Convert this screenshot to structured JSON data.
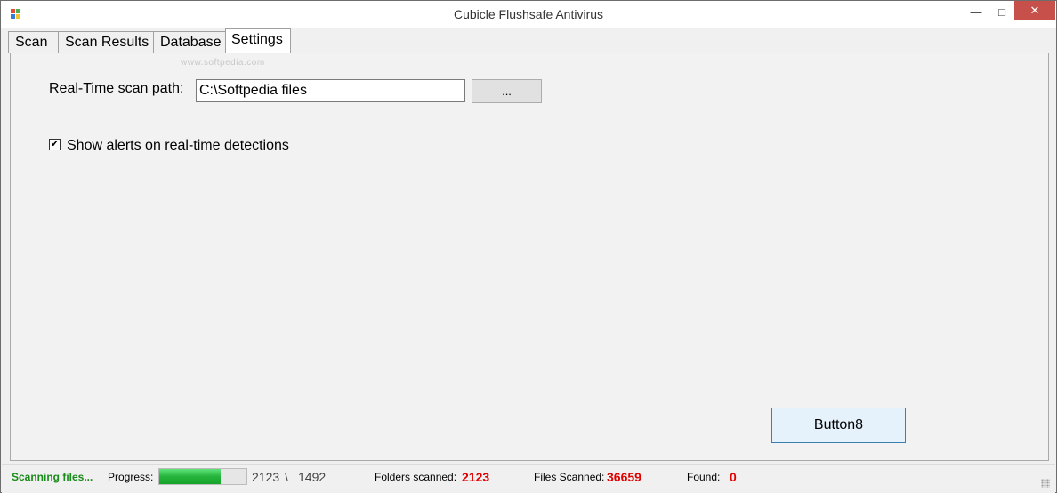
{
  "window": {
    "title": "Cubicle Flushsafe Antivirus",
    "controls": {
      "minimize": "—",
      "maximize": "□",
      "close": "✕"
    }
  },
  "tabs": [
    {
      "label": "Scan",
      "active": false
    },
    {
      "label": "Scan Results",
      "active": false
    },
    {
      "label": "Database",
      "active": false
    },
    {
      "label": "Settings",
      "active": true
    }
  ],
  "watermark": "www.softpedia.com",
  "settings": {
    "scan_path_label": "Real-Time scan path:",
    "scan_path_value": "C:\\Softpedia files",
    "browse_label": "...",
    "alerts_checkbox_label": "Show alerts on real-time detections",
    "alerts_checked": true,
    "button8_label": "Button8"
  },
  "status": {
    "scanning": "Scanning files...",
    "progress_label": "Progress:",
    "progress_fraction": 0.7,
    "count_a": "2123",
    "separator": "\\",
    "count_b": "1492",
    "folders_label": "Folders scanned:",
    "folders_value": "2123",
    "files_label": "Files Scanned:",
    "files_value": "36659",
    "found_label": "Found:",
    "found_value": "0"
  },
  "colors": {
    "accent_red": "#e00000",
    "status_green": "#1a8a1a",
    "progress_green": "#26b43c",
    "close_button": "#c7504a"
  }
}
